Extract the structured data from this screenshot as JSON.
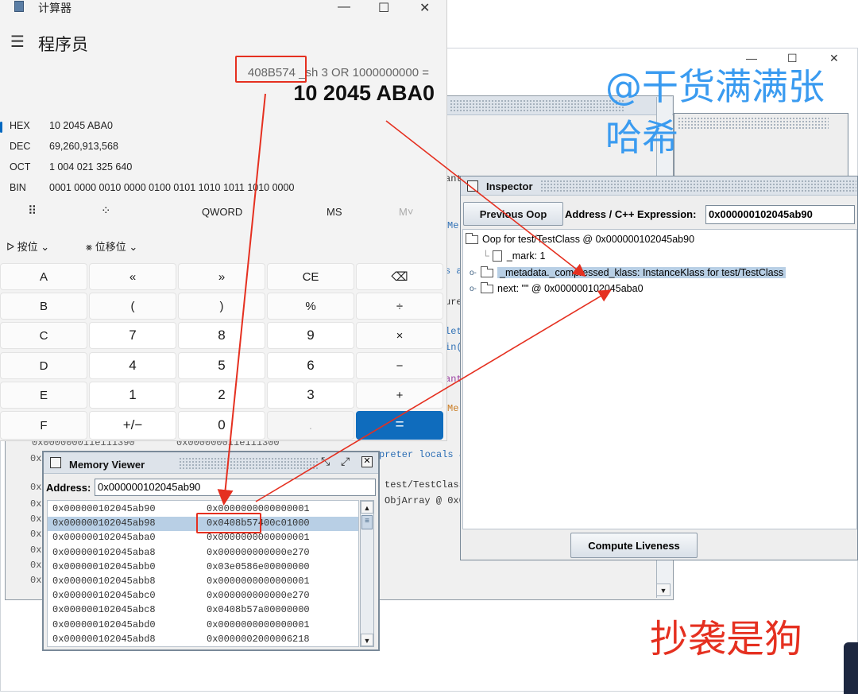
{
  "calculator": {
    "title": "计算器",
    "mode": "程序员",
    "expression": "408B574 _sh 3 OR 1000000000 =",
    "result": "10 2045 ABA0",
    "bases": [
      {
        "name": "HEX",
        "value": "10 2045 ABA0"
      },
      {
        "name": "DEC",
        "value": "69,260,913,568"
      },
      {
        "name": "OCT",
        "value": "1 004 021 325 640"
      },
      {
        "name": "BIN",
        "value": "0001 0000 0010 0000 0100 0101 1010 1011 1010 0000"
      }
    ],
    "word_size": "QWORD",
    "memory_store": "MS",
    "memory_list": "M˅",
    "bitwise_label": "按位",
    "bitshift_label": "位移位",
    "keys": [
      [
        "A",
        "«",
        "»",
        "CE",
        "⌫"
      ],
      [
        "B",
        "(",
        ")",
        "%",
        "÷"
      ],
      [
        "C",
        "7",
        "8",
        "9",
        "×"
      ],
      [
        "D",
        "4",
        "5",
        "6",
        "−"
      ],
      [
        "E",
        "1",
        "2",
        "3",
        "+"
      ],
      [
        "F",
        "+/−",
        "0",
        ".",
        "="
      ]
    ]
  },
  "inspector": {
    "title": "Inspector",
    "prev_oop_button": "Previous Oop",
    "address_label": "Address / C++ Expression:",
    "address_value": "0x000000102045ab90",
    "tree": [
      {
        "label": "Oop for test/TestClass @ 0x000000102045ab90"
      },
      {
        "label": "_mark: 1"
      },
      {
        "label": "_metadata._compressed_klass: InstanceKlass for test/TestClass"
      },
      {
        "label": "next: \"\" @ 0x000000102045aba0"
      }
    ],
    "compute_button": "Compute Liveness"
  },
  "memory_viewer": {
    "title": "Memory Viewer",
    "address_label": "Address:",
    "address_value": "0x000000102045ab90",
    "rows": [
      {
        "addr": "0x000000102045ab90",
        "val": "0x0000000000000001"
      },
      {
        "addr": "0x000000102045ab98",
        "val": "0x0408b57400c01000"
      },
      {
        "addr": "0x000000102045aba0",
        "val": "0x0000000000000001"
      },
      {
        "addr": "0x000000102045aba8",
        "val": "0x000000000000e270"
      },
      {
        "addr": "0x000000102045abb0",
        "val": "0x03e0586e00000000"
      },
      {
        "addr": "0x000000102045abb8",
        "val": "0x0000000000000001"
      },
      {
        "addr": "0x000000102045abc0",
        "val": "0x000000000000e270"
      },
      {
        "addr": "0x000000102045abc8",
        "val": "0x0408b57a00000000"
      },
      {
        "addr": "0x000000102045abd0",
        "val": "0x0000000000000001"
      },
      {
        "addr": "0x000000102045abd8",
        "val": "0x0000002000006218"
      }
    ]
  },
  "background": {
    "fragments": [
      "ant",
      "Me",
      "s a",
      "ure",
      "let",
      "in(",
      "ant",
      "Me",
      "preter locals a",
      "test/TestClass",
      "ObjArray @ 0x0",
      "0x000000011e111390",
      "0x000000011e111300"
    ]
  },
  "annotations": {
    "watermark_blue": "@干货满满张哈希",
    "watermark_red": "抄袭是狗"
  },
  "colors": {
    "accent": "#0f6cbd",
    "annotation_red": "#e53020",
    "watermark_blue": "#3a9bf0"
  }
}
